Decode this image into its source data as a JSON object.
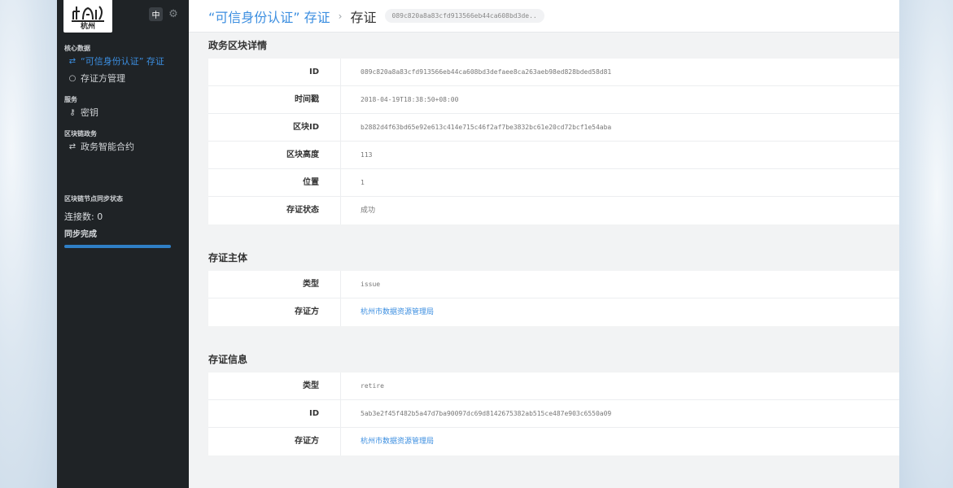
{
  "sidebar": {
    "logo_text": "杭州",
    "lang_label": "中",
    "sections": [
      {
        "title": "核心数据",
        "items": [
          {
            "label": "“可信身份认证” 存证",
            "active": true,
            "icon": "swap-icon"
          },
          {
            "label": "存证方管理",
            "active": false,
            "icon": "circle-icon"
          }
        ]
      },
      {
        "title": "服务",
        "items": [
          {
            "label": "密钥",
            "active": false,
            "icon": "key-icon"
          }
        ]
      },
      {
        "title": "区块链政务",
        "items": [
          {
            "label": "政务智能合约",
            "active": false,
            "icon": "swap-icon"
          }
        ]
      }
    ],
    "sync": {
      "title": "区块链节点同步状态",
      "connections": "连接数: 0",
      "status": "同步完成",
      "progress": 1.0
    }
  },
  "header": {
    "breadcrumb_link": "“可信身份认证” 存证",
    "breadcrumb_sep": "›",
    "breadcrumb_current": "存证",
    "hash": "089c820a8a83cfd913566eb44ca608bd3de.."
  },
  "block_details": {
    "title": "政务区块详情",
    "rows": [
      {
        "label": "ID",
        "value": "089c820a8a83cfd913566eb44ca608bd3defaee8ca263aeb98ed828bded58d81"
      },
      {
        "label": "时间戳",
        "value": "2018-04-19T18:38:50+08:00"
      },
      {
        "label": "区块ID",
        "value": "b2882d4f63bd65e92e613c414e715c46f2af7be3832bc61e20cd72bcf1e54aba"
      },
      {
        "label": "区块高度",
        "value": "113"
      },
      {
        "label": "位置",
        "value": "1"
      },
      {
        "label": "存证状态",
        "value": "成功"
      }
    ]
  },
  "subject": {
    "title": "存证主体",
    "rows": [
      {
        "label": "类型",
        "value": "issue"
      },
      {
        "label": "存证方",
        "value": "杭州市数据资源管理局"
      }
    ]
  },
  "info": {
    "title": "存证信息",
    "rows": [
      {
        "label": "类型",
        "value": "retire"
      },
      {
        "label": "ID",
        "value": "5ab3e2f45f482b5a47d7ba90097dc69d8142675382ab515ce487e903c6550a09"
      },
      {
        "label": "存证方",
        "value": "杭州市数据资源管理局"
      }
    ]
  },
  "colors": {
    "accent": "#3b8ee0",
    "sidebar_bg": "#1f2326",
    "progress": "#2f7fc6"
  }
}
